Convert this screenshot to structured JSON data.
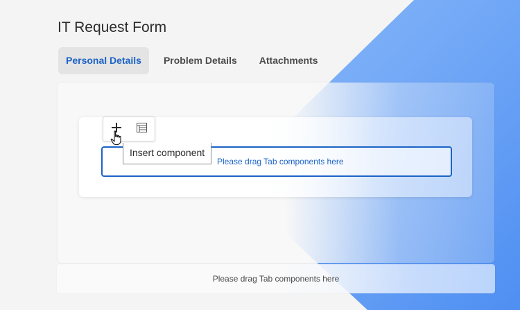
{
  "page": {
    "title": "IT Request Form"
  },
  "tabs": [
    {
      "label": "Personal Details",
      "active": true
    },
    {
      "label": "Problem Details",
      "active": false
    },
    {
      "label": "Attachments",
      "active": false
    }
  ],
  "toolbar": {
    "insert_icon": "plus-icon",
    "properties_icon": "table-icon"
  },
  "tooltip": {
    "text": "Insert component"
  },
  "drop_zone": {
    "text": "Please drag Tab components here"
  },
  "footer": {
    "text": "Please drag Tab components here"
  },
  "colors": {
    "accent": "#1b63c6",
    "background_blue": "#76abf7"
  }
}
